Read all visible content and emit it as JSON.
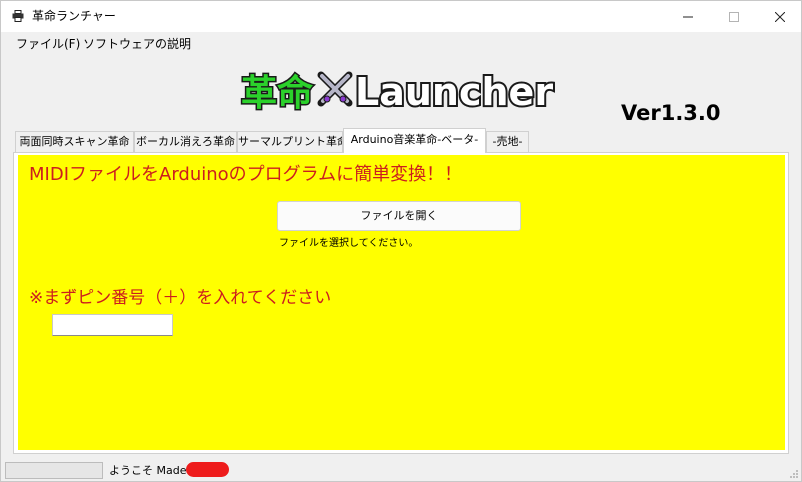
{
  "window": {
    "title": "革命ランチャー"
  },
  "menu": {
    "items": [
      "ファイル(F)",
      "ソフトウェアの説明"
    ]
  },
  "header": {
    "logo_text": "革命 Launcher",
    "version": "Ver1.3.0"
  },
  "tabs": [
    {
      "label": "両面同時スキャン革命",
      "active": false
    },
    {
      "label": "ボーカル消えろ革命",
      "active": false
    },
    {
      "label": "サーマルプリント革命",
      "active": false
    },
    {
      "label": "Arduino音楽革命-ベータ-",
      "active": true
    },
    {
      "label": "-売地-",
      "active": false
    }
  ],
  "panel": {
    "heading": "MIDIファイルをArduinoのプログラムに簡単変換！！",
    "open_button_label": "ファイルを開く",
    "file_status": "ファイルを選択してください。",
    "pin_heading": "※まずピン番号（＋）を入れてください",
    "pin_value": "",
    "background_color": "#ffff00",
    "text_color": "#cc1e1e"
  },
  "statusbar": {
    "progress": 0,
    "text": "ようこそ Made in",
    "redaction_color": "#ee1c1c"
  },
  "icons": {
    "app": "printer-icon",
    "minimize": "minimize-icon",
    "maximize": "maximize-icon",
    "close": "close-icon",
    "logo_emblem": "crossed-swords-icon",
    "resize": "resize-grip-icon"
  }
}
